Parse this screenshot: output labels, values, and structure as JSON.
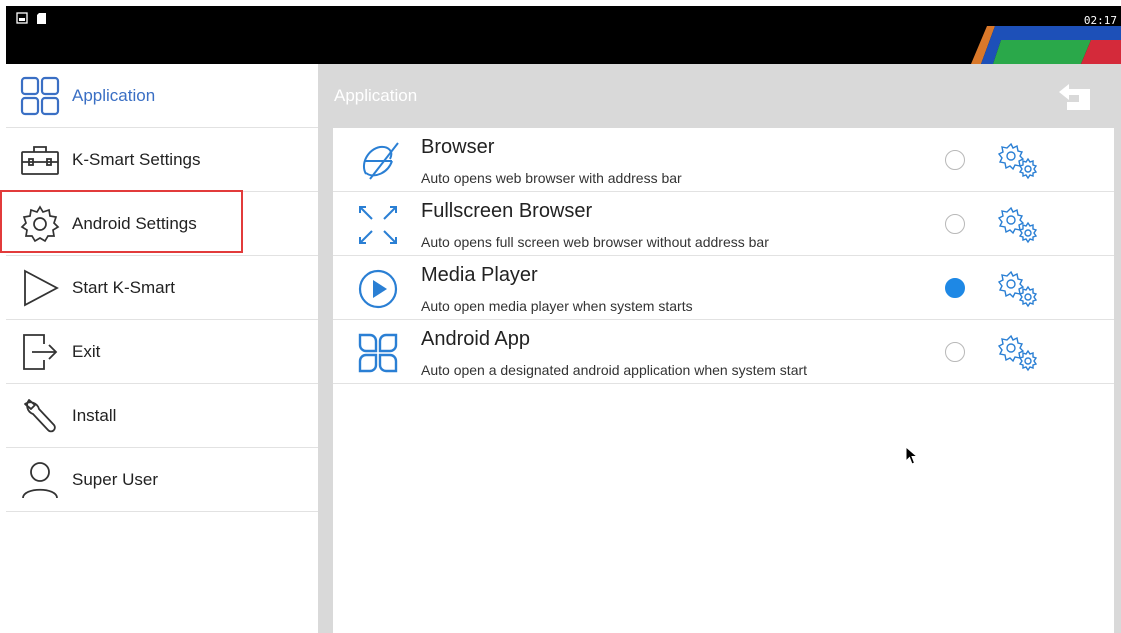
{
  "status_bar": {
    "time": "02:17",
    "icons": [
      "image-icon",
      "sd-card-icon"
    ]
  },
  "sidebar": {
    "items": [
      {
        "label": "Application",
        "icon": "grid-icon",
        "active": true
      },
      {
        "label": "K-Smart Settings",
        "icon": "toolbox-icon",
        "active": false
      },
      {
        "label": "Android Settings",
        "icon": "gear-icon",
        "active": false
      },
      {
        "label": "Start K-Smart",
        "icon": "play-triangle-icon",
        "active": false
      },
      {
        "label": "Exit",
        "icon": "exit-icon",
        "active": false
      },
      {
        "label": "Install",
        "icon": "wrench-icon",
        "active": false
      },
      {
        "label": "Super User",
        "icon": "user-icon",
        "active": false
      }
    ]
  },
  "main": {
    "title": "Application",
    "apps": [
      {
        "title": "Browser",
        "desc": "Auto opens web browser with address bar",
        "icon": "browser-icon",
        "selected": false
      },
      {
        "title": "Fullscreen Browser",
        "desc": "Auto opens full screen web browser without address bar",
        "icon": "fullscreen-icon",
        "selected": false
      },
      {
        "title": "Media Player",
        "desc": "Auto open media player when system starts",
        "icon": "play-circle-icon",
        "selected": true
      },
      {
        "title": "Android App",
        "desc": "Auto open a designated android application when system start",
        "icon": "android-app-icon",
        "selected": false
      }
    ]
  },
  "colors": {
    "accent": "#3a6fc4",
    "icon_blue": "#2a7fd4",
    "highlight": "#e23b3b",
    "radio_selected": "#1e88e5"
  }
}
